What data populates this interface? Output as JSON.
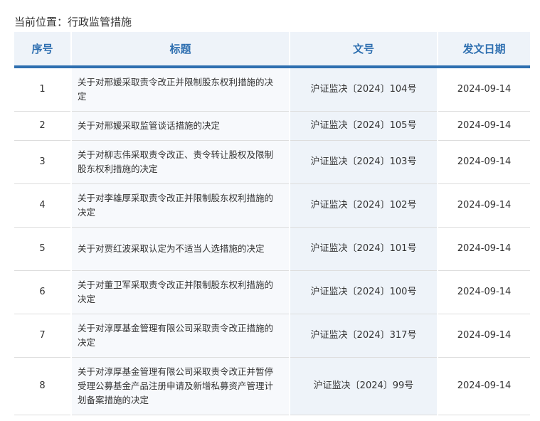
{
  "breadcrumb": "当前位置：行政监管措施",
  "table": {
    "headers": {
      "index": "序号",
      "title": "标题",
      "doc_no": "文号",
      "date": "发文日期"
    },
    "rows": [
      {
        "index": "1",
        "title": "关于对邢媛采取责令改正并限制股东权利措施的决定",
        "doc_no": "沪证监决〔2024〕104号",
        "date": "2024-09-14"
      },
      {
        "index": "2",
        "title": "关于对邢媛采取监管谈话措施的决定",
        "doc_no": "沪证监决〔2024〕105号",
        "date": "2024-09-14"
      },
      {
        "index": "3",
        "title": "关于对柳志伟采取责令改正、责令转让股权及限制股东权利措施的决定",
        "doc_no": "沪证监决〔2024〕103号",
        "date": "2024-09-14"
      },
      {
        "index": "4",
        "title": "关于对李雄厚采取责令改正并限制股东权利措施的决定",
        "doc_no": "沪证监决〔2024〕102号",
        "date": "2024-09-14"
      },
      {
        "index": "5",
        "title": "关于对贾红波采取认定为不适当人选措施的决定",
        "doc_no": "沪证监决〔2024〕101号",
        "date": "2024-09-14"
      },
      {
        "index": "6",
        "title": "关于对董卫军采取责令改正并限制股东权利措施的决定",
        "doc_no": "沪证监决〔2024〕100号",
        "date": "2024-09-14"
      },
      {
        "index": "7",
        "title": "关于对淳厚基金管理有限公司采取责令改正措施的决定",
        "doc_no": "沪证监决〔2024〕317号",
        "date": "2024-09-14"
      },
      {
        "index": "8",
        "title": "关于对淳厚基金管理有限公司采取责令改正并暂停受理公募基金产品注册申请及新增私募资产管理计划备案措施的决定",
        "doc_no": "沪证监决〔2024〕99号",
        "date": "2024-09-14"
      }
    ]
  },
  "colors": {
    "accent": "#2e6fb0",
    "header_bg": "#eef3f9",
    "doc_col_bg": "#eef3f9",
    "title_col_bg": "#f7f9fc",
    "border": "#dddddd"
  }
}
